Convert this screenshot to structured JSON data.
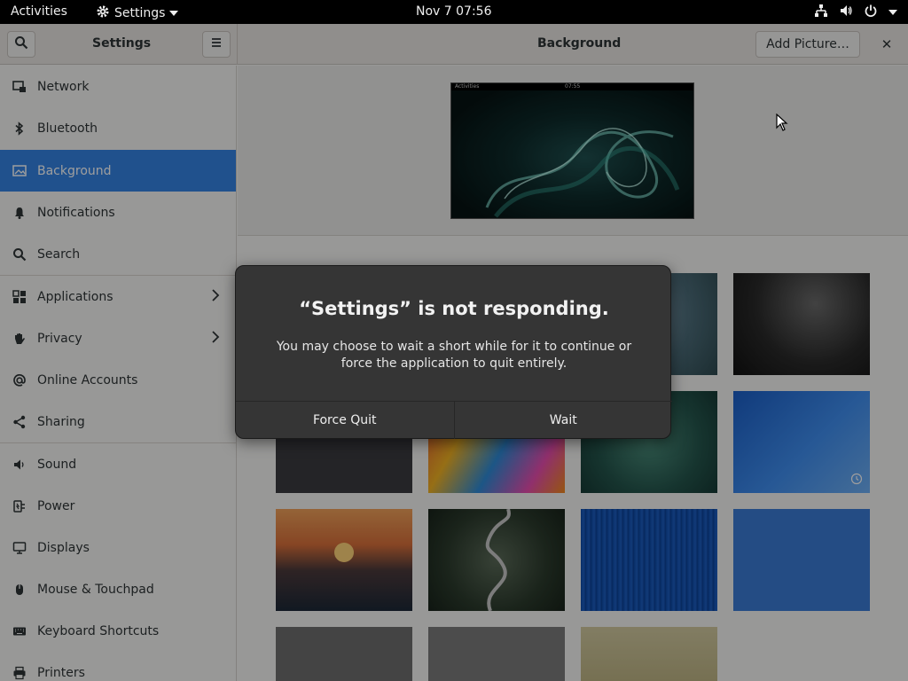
{
  "topbar": {
    "activities": "Activities",
    "app_name": "Settings",
    "clock": "Nov 7  07:56"
  },
  "header": {
    "sidebar_title": "Settings",
    "page_title": "Background",
    "add_picture": "Add Picture…",
    "close": "✕"
  },
  "sidebar": {
    "items": [
      {
        "label": "Network",
        "icon": "network-icon"
      },
      {
        "label": "Bluetooth",
        "icon": "bluetooth-icon"
      },
      {
        "label": "Background",
        "icon": "background-icon",
        "active": true
      },
      {
        "label": "Notifications",
        "icon": "bell-icon"
      },
      {
        "label": "Search",
        "icon": "search-icon"
      },
      {
        "label": "Applications",
        "icon": "apps-grid-icon",
        "has_submenu": true
      },
      {
        "label": "Privacy",
        "icon": "hand-icon",
        "has_submenu": true
      },
      {
        "label": "Online Accounts",
        "icon": "at-icon"
      },
      {
        "label": "Sharing",
        "icon": "share-icon"
      },
      {
        "label": "Sound",
        "icon": "speaker-icon"
      },
      {
        "label": "Power",
        "icon": "power-plug-icon"
      },
      {
        "label": "Displays",
        "icon": "display-icon"
      },
      {
        "label": "Mouse & Touchpad",
        "icon": "mouse-icon"
      },
      {
        "label": "Keyboard Shortcuts",
        "icon": "keyboard-icon"
      },
      {
        "label": "Printers",
        "icon": "printer-icon"
      }
    ]
  },
  "preview": {
    "activities": "Activities",
    "clock": "07:55"
  },
  "dialog": {
    "title": "“Settings” is not responding.",
    "body": "You may choose to wait a short while for it to continue or force the application to quit entirely.",
    "force_quit": "Force Quit",
    "wait": "Wait"
  },
  "colors": {
    "accent": "#3584e4",
    "topbar": "#000000",
    "dialog": "#353535"
  }
}
